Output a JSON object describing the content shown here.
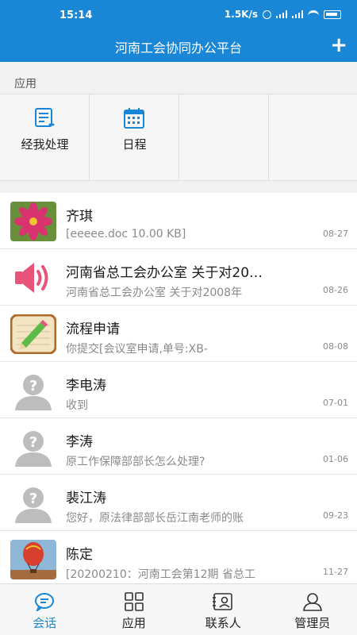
{
  "status_bar": {
    "time": "15:14",
    "network_speed": "1.5K/s"
  },
  "header": {
    "title": "河南工会协同办公平台",
    "add_label": "+"
  },
  "apps_section": {
    "label": "应用",
    "items": [
      {
        "label": "经我处理",
        "icon": "document-list-icon"
      },
      {
        "label": "日程",
        "icon": "calendar-icon"
      }
    ]
  },
  "conversations": [
    {
      "name": "齐琪",
      "preview": "[eeeee.doc 10.00 KB]",
      "date": "08-27",
      "avatar": "flower-photo"
    },
    {
      "name": "河南省总工会办公室 关于对20…",
      "preview": "河南省总工会办公室 关于对2008年",
      "date": "08-26",
      "avatar": "speaker-icon"
    },
    {
      "name": "流程申请",
      "preview": "你提交[会议室申请,单号:XB-",
      "date": "08-08",
      "avatar": "pencil-notepad-icon"
    },
    {
      "name": "李电涛",
      "preview": "收到",
      "date": "07-01",
      "avatar": "unknown-user-icon"
    },
    {
      "name": "李涛",
      "preview": "原工作保障部部长怎么处理?",
      "date": "01-06",
      "avatar": "unknown-user-icon"
    },
    {
      "name": "裴江涛",
      "preview": "您好，原法律部部长岳江南老师的账",
      "date": "09-23",
      "avatar": "unknown-user-icon"
    },
    {
      "name": "陈定",
      "preview": "[20200210：河南工会第12期 省总工",
      "date": "11-27",
      "avatar": "balloon-photo"
    }
  ],
  "tab_bar": {
    "tabs": [
      {
        "label": "会话",
        "icon": "chat-bubble-icon",
        "active": true
      },
      {
        "label": "应用",
        "icon": "grid-icon",
        "active": false
      },
      {
        "label": "联系人",
        "icon": "contact-card-icon",
        "active": false
      },
      {
        "label": "管理员",
        "icon": "person-icon",
        "active": false
      }
    ]
  },
  "colors": {
    "brand_blue": "#1a86d6",
    "muted_text": "#8a8a8a"
  }
}
